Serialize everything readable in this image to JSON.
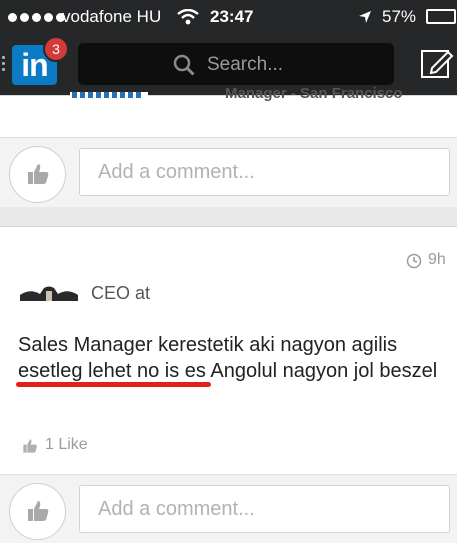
{
  "status_bar": {
    "carrier": "vodafone HU",
    "time": "23:47",
    "battery": "57%"
  },
  "header": {
    "logo_text": "in",
    "notification_count": "3",
    "search_placeholder": "Search..."
  },
  "feed": {
    "previous_post": {
      "peek_text": "Manager - San Francisco",
      "comment_placeholder": "Add a comment..."
    },
    "post": {
      "time_ago": "9h",
      "author_title": "CEO at",
      "text": "Sales Manager kerestetik aki nagyon agilis esetleg lehet no is es Angolul nagyon jol beszel",
      "likes": "1 Like",
      "comment_placeholder": "Add a comment..."
    }
  },
  "colors": {
    "header_bg": "#262729",
    "linkedin_blue": "#0a7bc4",
    "badge_red": "#d43a3a",
    "annotation_red": "#e0221b"
  }
}
